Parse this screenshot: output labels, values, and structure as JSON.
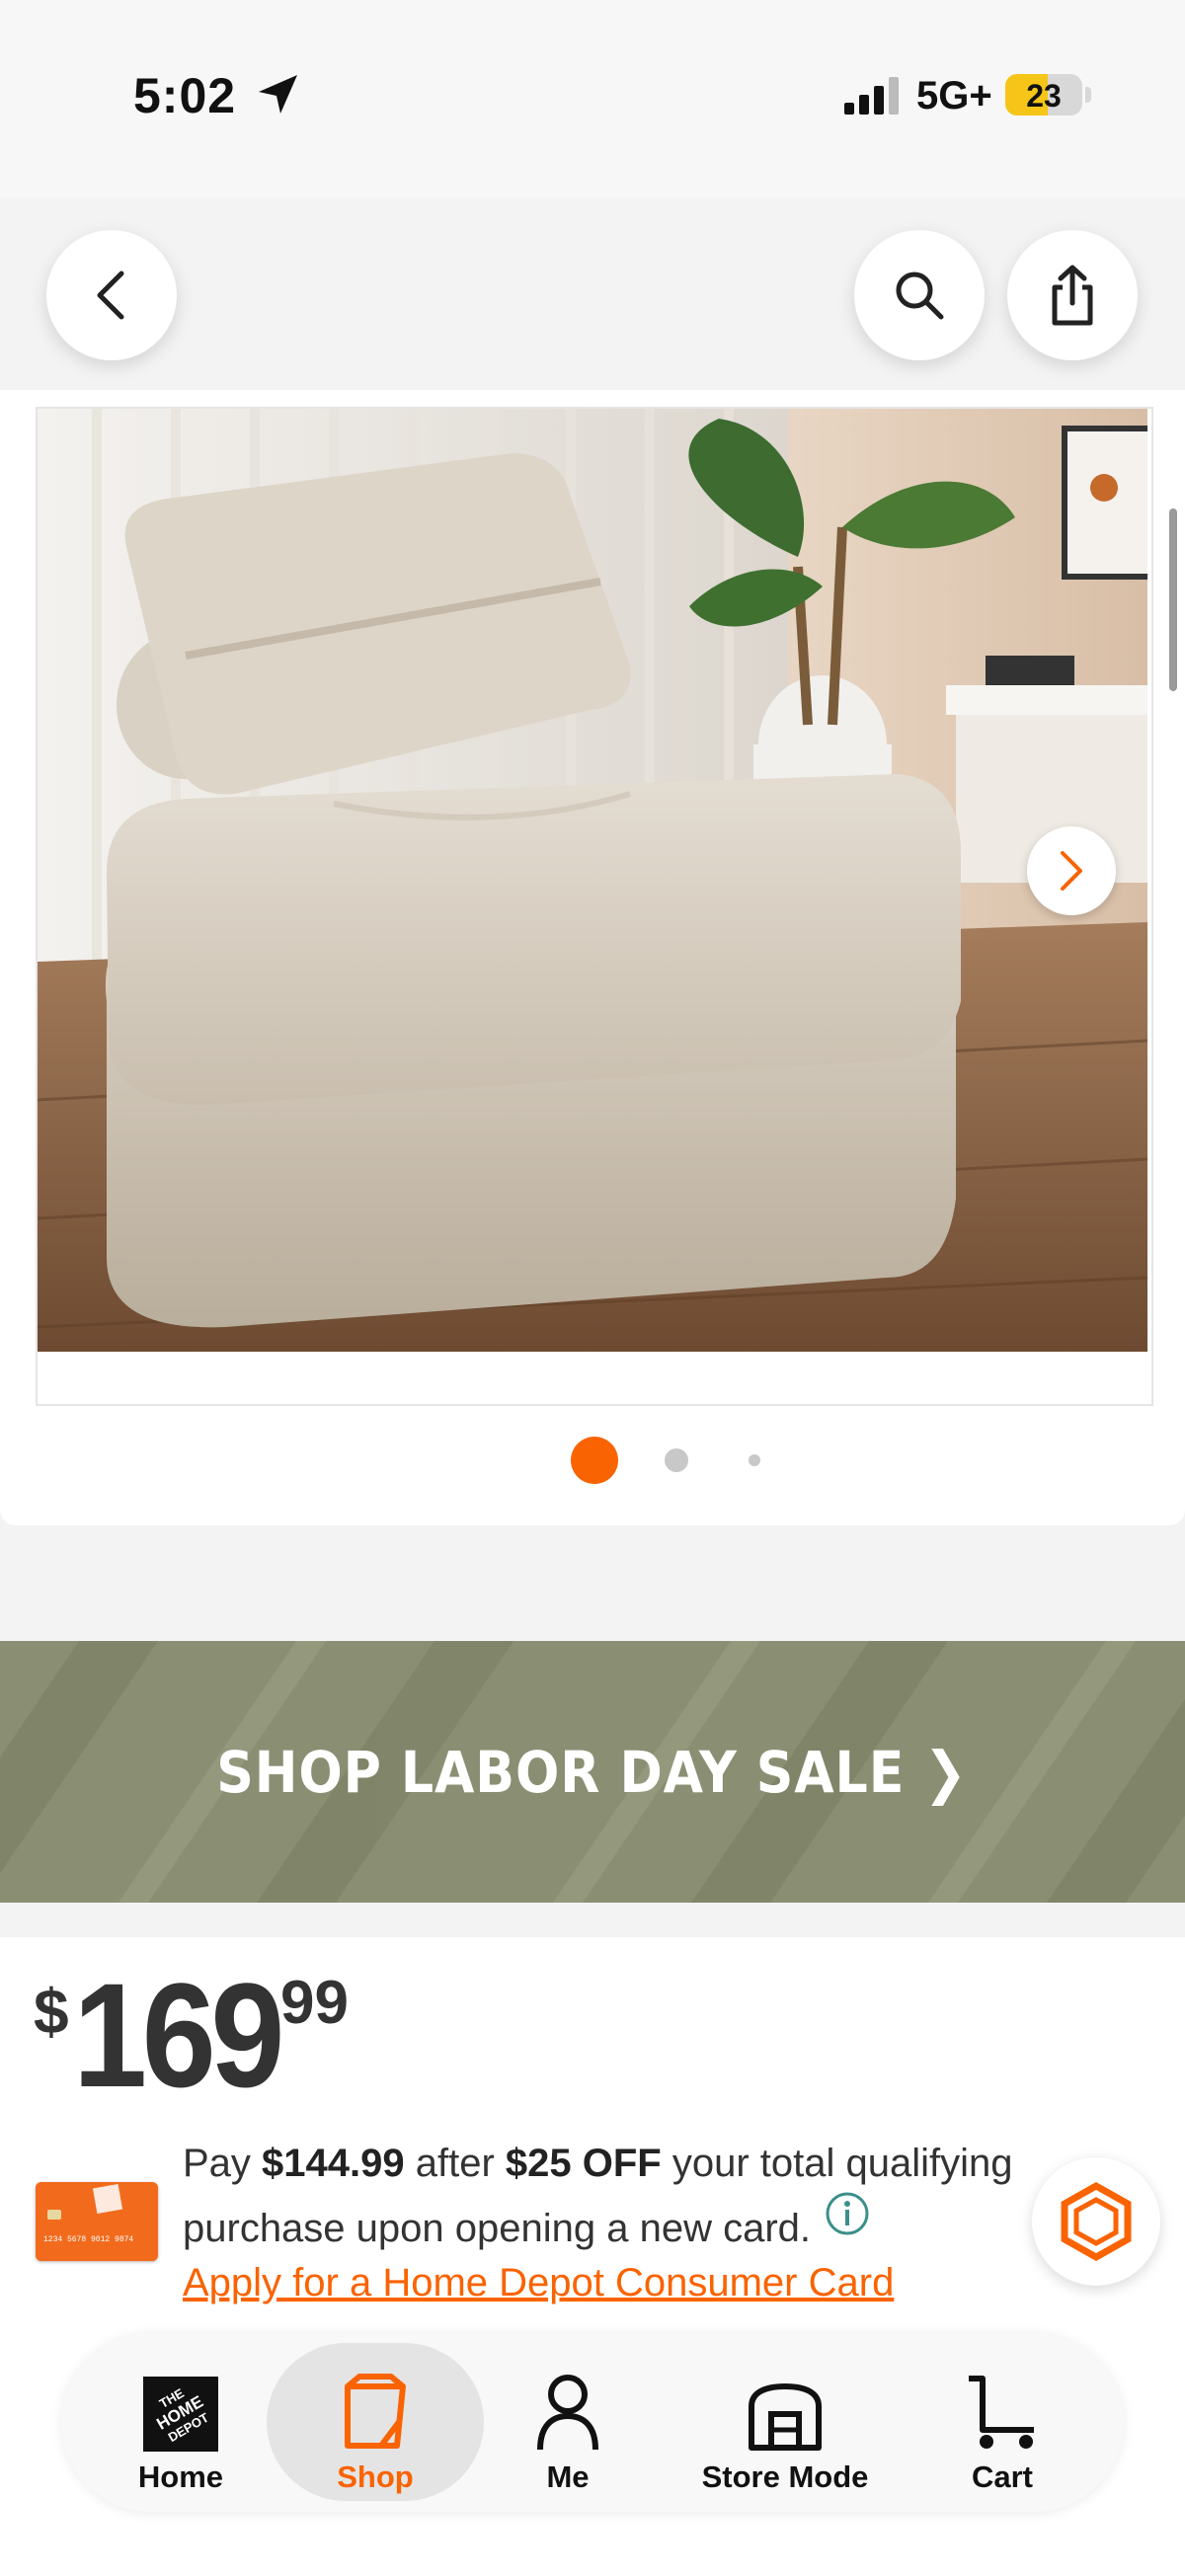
{
  "status_bar": {
    "time": "5:02",
    "network": "5G+",
    "battery": "23",
    "battery_level_percent": 23
  },
  "header": {
    "back_icon": "chevron-left-icon",
    "search_icon": "search-icon",
    "share_icon": "share-icon"
  },
  "gallery": {
    "image_count": 3,
    "active_index": 0,
    "next_icon": "chevron-right-icon"
  },
  "banner": {
    "text": "SHOP LABOR DAY SALE ❯",
    "background": "#8a8f73"
  },
  "price": {
    "currency": "$",
    "dollars": "169",
    "cents": "99"
  },
  "offer": {
    "pay_prefix": "Pay ",
    "pay_amount": "$144.99",
    "after": " after ",
    "discount": "$25 OFF",
    "rest": " your total qualifying purchase upon opening a new card.",
    "link": "Apply for a Home Depot Consumer Card",
    "card_logo_text": "THE HOME DEPOT",
    "card_number_text": "1234 5678 9012 9874"
  },
  "tabbar": {
    "items": [
      {
        "label": "Home",
        "icon": "home-depot-logo-icon"
      },
      {
        "label": "Shop",
        "icon": "shop-bag-icon",
        "active": true
      },
      {
        "label": "Me",
        "icon": "person-icon"
      },
      {
        "label": "Store Mode",
        "icon": "store-icon"
      },
      {
        "label": "Cart",
        "icon": "cart-icon"
      }
    ]
  },
  "colors": {
    "brand_orange": "#f96302",
    "active_tab_bg": "#e4e4e4"
  }
}
